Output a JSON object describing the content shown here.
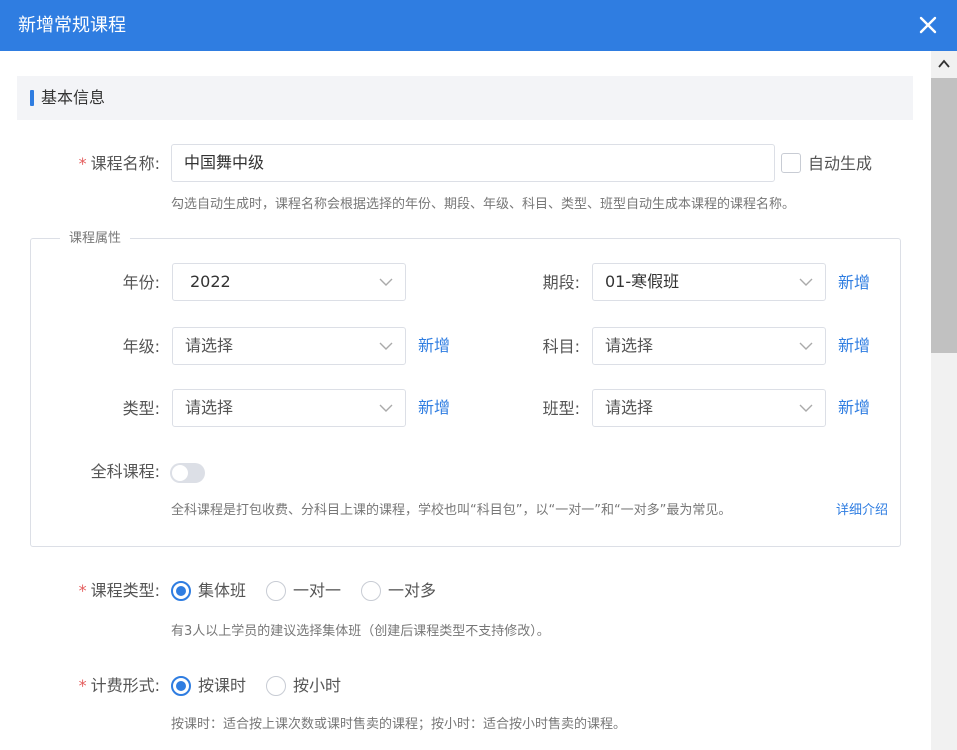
{
  "dialog": {
    "title": "新增常规课程"
  },
  "section": {
    "title": "基本信息"
  },
  "course_name": {
    "label": "课程名称:",
    "value": "中国舞中级",
    "auto_label": "自动生成",
    "hint": "勾选自动生成时，课程名称会根据选择的年份、期段、年级、科目、类型、班型自动生成本课程的课程名称。"
  },
  "attributes": {
    "legend": "课程属性",
    "year": {
      "label": "年份:",
      "value": "2022"
    },
    "period": {
      "label": "期段:",
      "value": "01-寒假班",
      "add": "新增"
    },
    "grade": {
      "label": "年级:",
      "placeholder": "请选择",
      "add": "新增"
    },
    "subject": {
      "label": "科目:",
      "placeholder": "请选择",
      "add": "新增"
    },
    "type": {
      "label": "类型:",
      "placeholder": "请选择",
      "add": "新增"
    },
    "class_type": {
      "label": "班型:",
      "placeholder": "请选择",
      "add": "新增"
    },
    "all_subject": {
      "label": "全科课程:",
      "enabled": false,
      "hint": "全科课程是打包收费、分科目上课的课程，学校也叫“科目包”，以“一对一”和“一对多”最为常见。",
      "detail_link": "详细介绍"
    }
  },
  "course_type": {
    "label": "课程类型:",
    "options": [
      "集体班",
      "一对一",
      "一对多"
    ],
    "selected": "集体班",
    "hint": "有3人以上学员的建议选择集体班（创建后课程类型不支持修改）。"
  },
  "billing": {
    "label": "计费形式:",
    "options": [
      "按课时",
      "按小时"
    ],
    "selected": "按课时",
    "hint": "按课时：适合按上课次数或课时售卖的课程；按小时：适合按小时售卖的课程。"
  },
  "colors": {
    "primary": "#2f7de1",
    "required": "#e45c5c",
    "section_bg": "#f3f4f7"
  }
}
